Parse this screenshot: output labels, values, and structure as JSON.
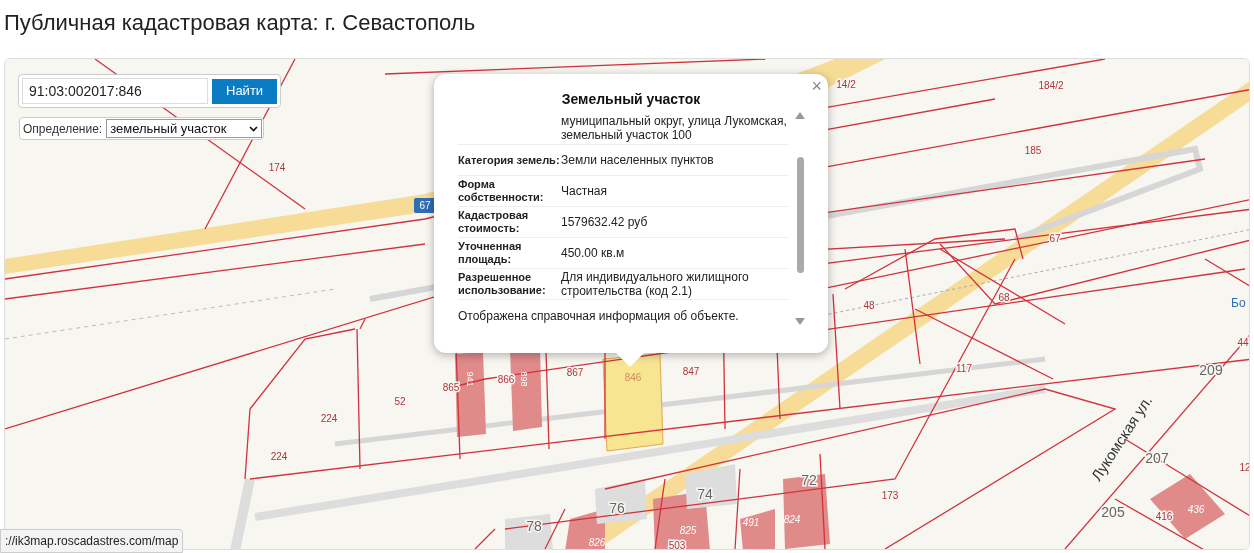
{
  "page_title": "Публичная кадастровая карта: г. Севастополь",
  "search": {
    "value": "91:03:002017:846",
    "button": "Найти"
  },
  "definition": {
    "label": "Определение:",
    "value": "земельный участок"
  },
  "popup": {
    "title": "Земельный участок",
    "close": "×",
    "address_lines": [
      "муниципальный округ, улица Лукомская,",
      "земельный участок 100"
    ],
    "rows": [
      {
        "label": "Категория земель:",
        "value": "Земли населенных пунктов"
      },
      {
        "label": "Форма собственности:",
        "value": "Частная"
      },
      {
        "label": "Кадастровая стоимость:",
        "value": "1579632.42 руб"
      },
      {
        "label": "Уточненная площадь:",
        "value": "450.00 кв.м"
      },
      {
        "label": "Разрешенное использование:",
        "value": "Для индивидуального жилищного строительства (код 2.1)"
      }
    ],
    "note": "Отображена справочная информация об объекте."
  },
  "map_labels": [
    {
      "text": "174",
      "kind": "parcel"
    },
    {
      "text": "67",
      "kind": "shield"
    },
    {
      "text": "14/2",
      "kind": "parcel"
    },
    {
      "text": "184/2",
      "kind": "parcel"
    },
    {
      "text": "185",
      "kind": "parcel"
    },
    {
      "text": "67",
      "kind": "parcel"
    },
    {
      "text": "68",
      "kind": "parcel"
    },
    {
      "text": "48",
      "kind": "parcel"
    },
    {
      "text": "117",
      "kind": "parcel"
    },
    {
      "text": "173",
      "kind": "parcel"
    },
    {
      "text": "224",
      "kind": "parcel"
    },
    {
      "text": "224",
      "kind": "parcel"
    },
    {
      "text": "52",
      "kind": "parcel"
    },
    {
      "text": "865",
      "kind": "parcel"
    },
    {
      "text": "866",
      "kind": "parcel"
    },
    {
      "text": "867",
      "kind": "parcel"
    },
    {
      "text": "846",
      "kind": "selected"
    },
    {
      "text": "847",
      "kind": "parcel"
    },
    {
      "text": "941",
      "kind": "building-vertical"
    },
    {
      "text": "898",
      "kind": "building-vertical"
    },
    {
      "text": "78",
      "kind": "house"
    },
    {
      "text": "76",
      "kind": "house"
    },
    {
      "text": "74",
      "kind": "house"
    },
    {
      "text": "72",
      "kind": "house"
    },
    {
      "text": "826",
      "kind": "building"
    },
    {
      "text": "825",
      "kind": "building"
    },
    {
      "text": "503",
      "kind": "parcel"
    },
    {
      "text": "491",
      "kind": "building"
    },
    {
      "text": "824",
      "kind": "building"
    },
    {
      "text": "207",
      "kind": "house"
    },
    {
      "text": "205",
      "kind": "house"
    },
    {
      "text": "416",
      "kind": "parcel"
    },
    {
      "text": "436",
      "kind": "building"
    },
    {
      "text": "209",
      "kind": "house"
    },
    {
      "text": "Бо",
      "kind": "place"
    },
    {
      "text": "44",
      "kind": "parcel"
    },
    {
      "text": "12",
      "kind": "parcel"
    },
    {
      "text": "Лукомская ул.",
      "kind": "street"
    }
  ],
  "status_url": "://ik3map.roscadastres.com/map"
}
